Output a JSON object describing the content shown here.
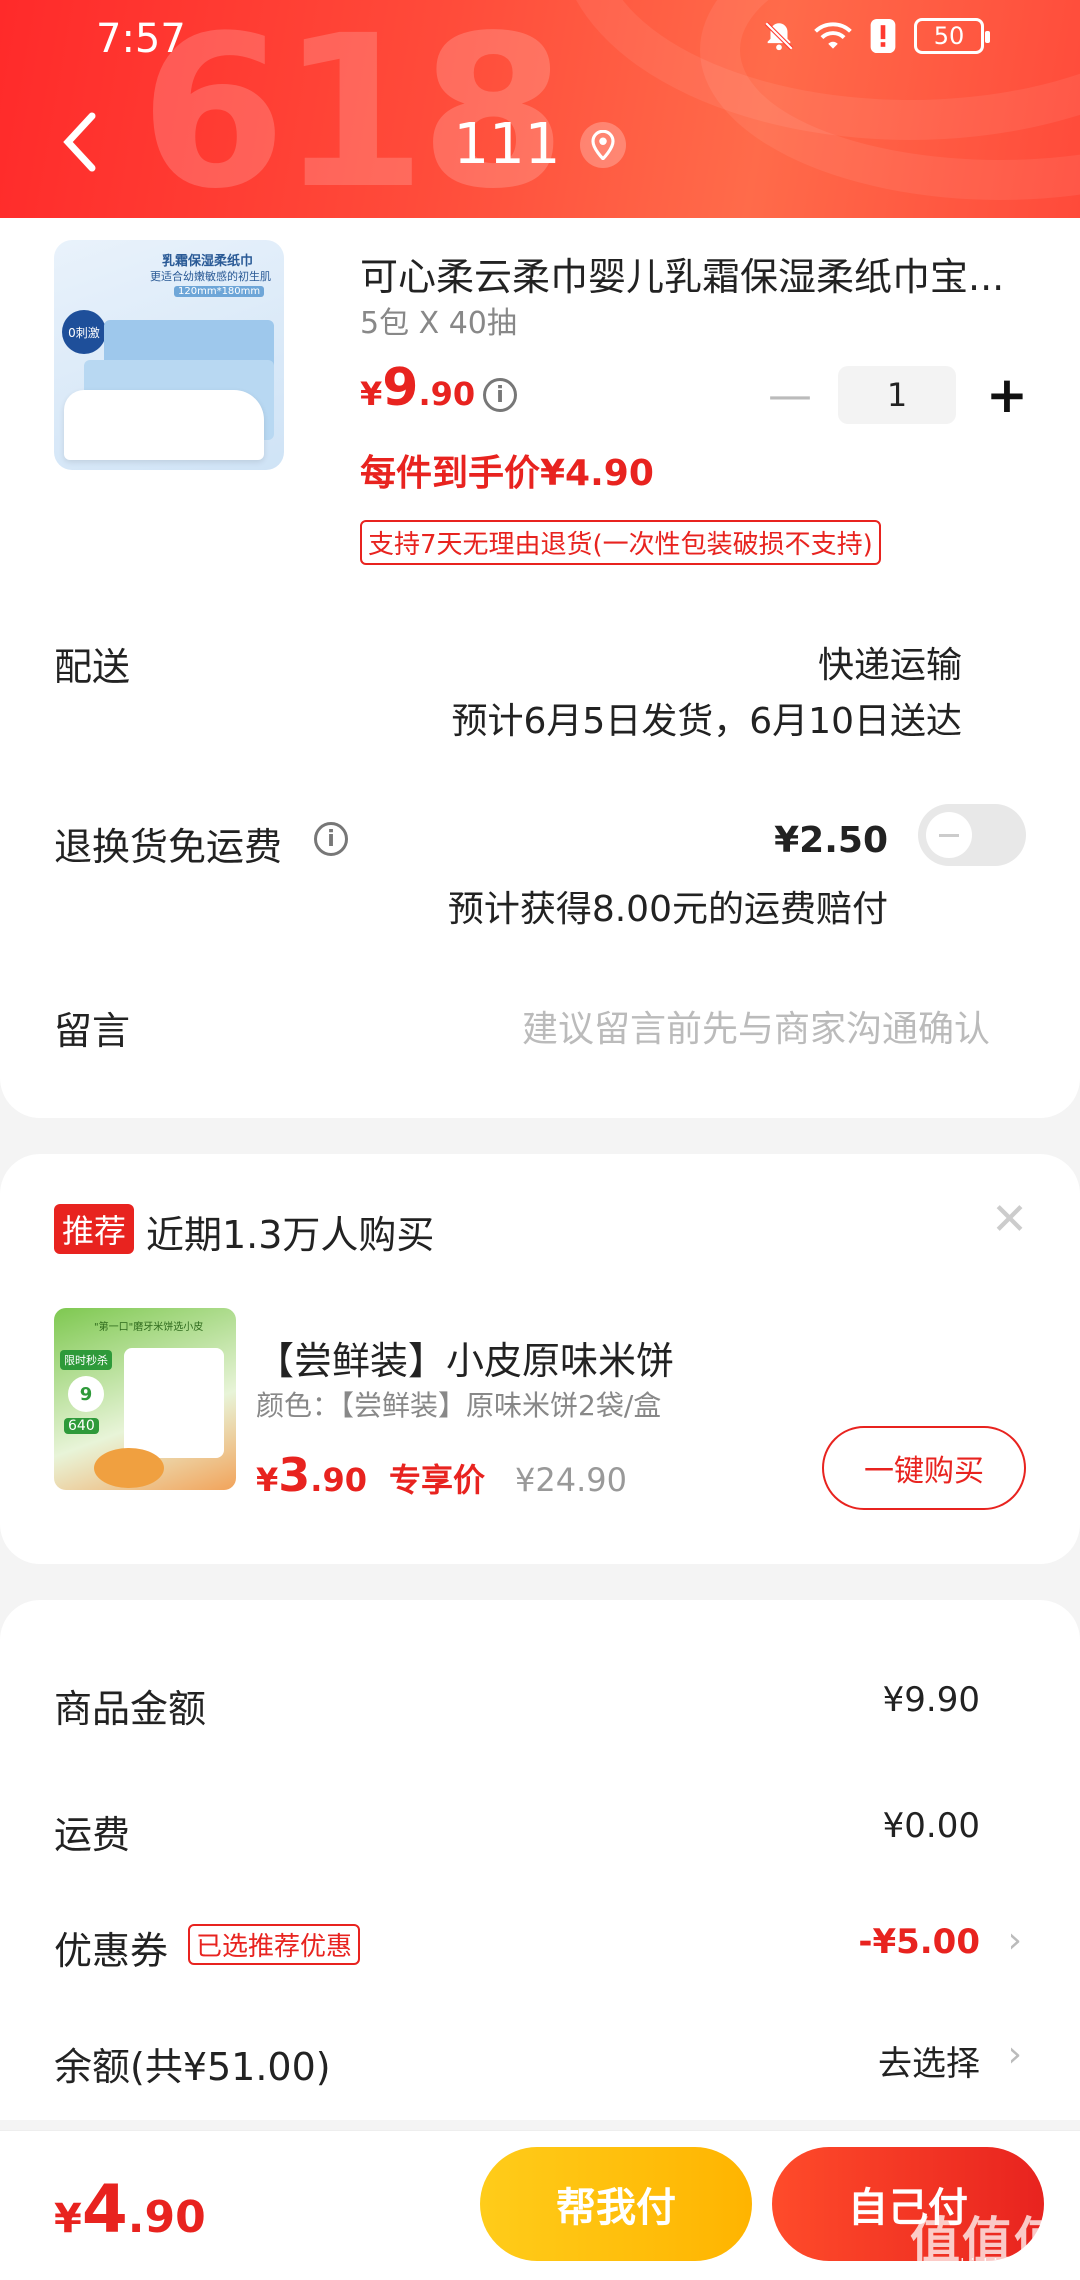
{
  "status": {
    "time": "7:57",
    "battery": "50"
  },
  "header": {
    "title": "111",
    "bg_text": "618"
  },
  "product": {
    "name": "可心柔云柔巾婴儿乳霜保湿柔纸巾宝...",
    "spec": "5包 X 40抽",
    "price_symbol": "¥",
    "price_int": "9",
    "price_dec": ".90",
    "quantity": "1",
    "deal_price": "每件到手价¥4.90",
    "policy": "支持7天无理由退货(一次性包装破损不支持)",
    "image_texts": {
      "line1": "乳霜保湿柔纸巾",
      "line2": "更适合幼嫩敏感的初生肌",
      "size": "120mm*180mm",
      "badge": "0刺激"
    }
  },
  "delivery": {
    "label": "配送",
    "method": "快递运输",
    "estimate": "预计6月5日发货，6月10日送达"
  },
  "return_fee": {
    "label": "退换货免运费",
    "price": "¥2.50",
    "note": "预计获得8.00元的运费赔付",
    "enabled": false
  },
  "message": {
    "label": "留言",
    "placeholder": "建议留言前先与商家沟通确认"
  },
  "recommend": {
    "tag": "推荐",
    "title": "近期1.3万人购买",
    "name": "【尝鲜装】小皮原味米饼",
    "color": "颜色：【尝鲜装】原味米饼2袋/盒",
    "price_symbol": "¥",
    "price_int": "3",
    "price_dec": ".90",
    "price_label": "专享价",
    "orig_price": "¥24.90",
    "button": "一键购买",
    "image_texts": {
      "line1": "\"第一口\"磨牙米饼选小皮",
      "badge1": "限时秒杀",
      "badge2": "9",
      "badge3": "640"
    }
  },
  "summary": {
    "goods_label": "商品金额",
    "goods_value": "¥9.90",
    "shipping_label": "运费",
    "shipping_value": "¥0.00",
    "coupon_label": "优惠券",
    "coupon_tag": "已选推荐优惠",
    "coupon_value": "-¥5.00",
    "balance_label": "余额(共¥51.00)",
    "balance_value": "去选择"
  },
  "bottom": {
    "total_symbol": "¥",
    "total_int": "4",
    "total_dec": ".90",
    "help_pay": "帮我付",
    "self_pay": "自己付",
    "watermark": "值值值",
    "watermark_url": "zhizhizhi.com"
  },
  "colors": {
    "accent": "#e8231f",
    "header": "#ff3a30",
    "help_button": "#ffc107"
  }
}
